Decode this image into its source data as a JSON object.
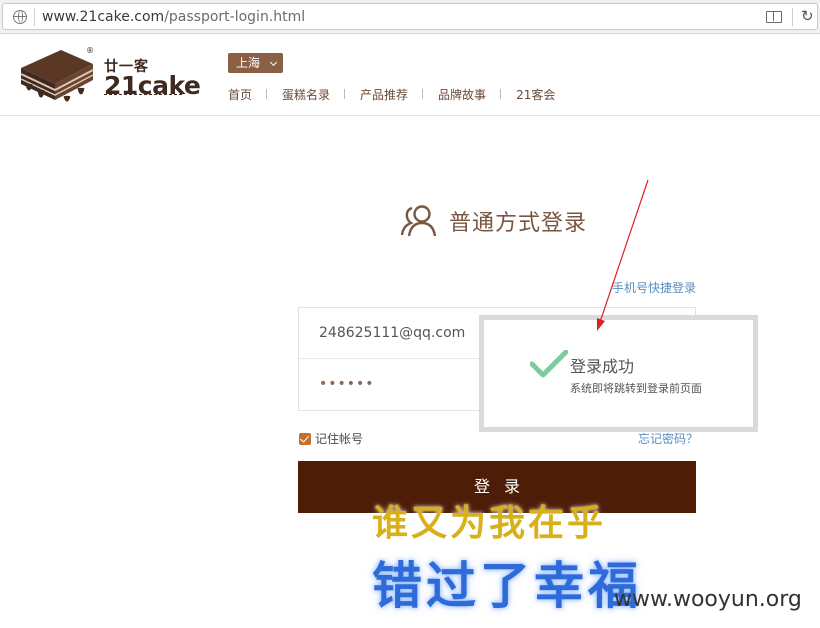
{
  "browser": {
    "url_host": "www.21cake.com",
    "url_path": "/passport-login.html"
  },
  "brand": {
    "cn_name": "廿一客",
    "en_name": "21cake",
    "reg_mark": "®",
    "colors": {
      "brown": "#4e1d07",
      "accent": "#8a5f45"
    }
  },
  "header": {
    "city": "上海",
    "nav": [
      "首页",
      "蛋糕名录",
      "产品推荐",
      "品牌故事",
      "21客会"
    ]
  },
  "login": {
    "title": "普通方式登录",
    "phone_login_link": "手机号快捷登录",
    "email_value": "248625111@qq.com",
    "password_value": "••••••",
    "remember_label": "记住帐号",
    "forgot_link": "忘记密码？",
    "submit_label": "登录"
  },
  "toast": {
    "title": "登录成功",
    "subtitle": "系统即将跳转到登录前页面"
  },
  "overlay": {
    "caption1": "谁又为我在乎",
    "caption2": "错过了幸福",
    "watermark": "www.wooyun.org"
  }
}
